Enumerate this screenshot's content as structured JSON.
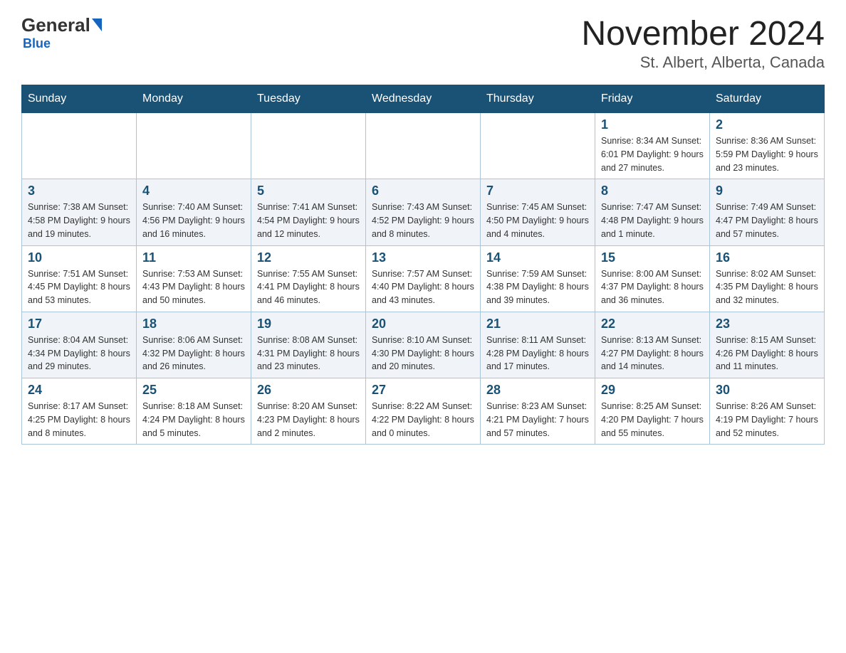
{
  "header": {
    "logo_text": "General",
    "logo_blue": "Blue",
    "main_title": "November 2024",
    "location": "St. Albert, Alberta, Canada"
  },
  "weekdays": [
    "Sunday",
    "Monday",
    "Tuesday",
    "Wednesday",
    "Thursday",
    "Friday",
    "Saturday"
  ],
  "weeks": [
    [
      {
        "day": "",
        "info": ""
      },
      {
        "day": "",
        "info": ""
      },
      {
        "day": "",
        "info": ""
      },
      {
        "day": "",
        "info": ""
      },
      {
        "day": "",
        "info": ""
      },
      {
        "day": "1",
        "info": "Sunrise: 8:34 AM\nSunset: 6:01 PM\nDaylight: 9 hours and 27 minutes."
      },
      {
        "day": "2",
        "info": "Sunrise: 8:36 AM\nSunset: 5:59 PM\nDaylight: 9 hours and 23 minutes."
      }
    ],
    [
      {
        "day": "3",
        "info": "Sunrise: 7:38 AM\nSunset: 4:58 PM\nDaylight: 9 hours and 19 minutes."
      },
      {
        "day": "4",
        "info": "Sunrise: 7:40 AM\nSunset: 4:56 PM\nDaylight: 9 hours and 16 minutes."
      },
      {
        "day": "5",
        "info": "Sunrise: 7:41 AM\nSunset: 4:54 PM\nDaylight: 9 hours and 12 minutes."
      },
      {
        "day": "6",
        "info": "Sunrise: 7:43 AM\nSunset: 4:52 PM\nDaylight: 9 hours and 8 minutes."
      },
      {
        "day": "7",
        "info": "Sunrise: 7:45 AM\nSunset: 4:50 PM\nDaylight: 9 hours and 4 minutes."
      },
      {
        "day": "8",
        "info": "Sunrise: 7:47 AM\nSunset: 4:48 PM\nDaylight: 9 hours and 1 minute."
      },
      {
        "day": "9",
        "info": "Sunrise: 7:49 AM\nSunset: 4:47 PM\nDaylight: 8 hours and 57 minutes."
      }
    ],
    [
      {
        "day": "10",
        "info": "Sunrise: 7:51 AM\nSunset: 4:45 PM\nDaylight: 8 hours and 53 minutes."
      },
      {
        "day": "11",
        "info": "Sunrise: 7:53 AM\nSunset: 4:43 PM\nDaylight: 8 hours and 50 minutes."
      },
      {
        "day": "12",
        "info": "Sunrise: 7:55 AM\nSunset: 4:41 PM\nDaylight: 8 hours and 46 minutes."
      },
      {
        "day": "13",
        "info": "Sunrise: 7:57 AM\nSunset: 4:40 PM\nDaylight: 8 hours and 43 minutes."
      },
      {
        "day": "14",
        "info": "Sunrise: 7:59 AM\nSunset: 4:38 PM\nDaylight: 8 hours and 39 minutes."
      },
      {
        "day": "15",
        "info": "Sunrise: 8:00 AM\nSunset: 4:37 PM\nDaylight: 8 hours and 36 minutes."
      },
      {
        "day": "16",
        "info": "Sunrise: 8:02 AM\nSunset: 4:35 PM\nDaylight: 8 hours and 32 minutes."
      }
    ],
    [
      {
        "day": "17",
        "info": "Sunrise: 8:04 AM\nSunset: 4:34 PM\nDaylight: 8 hours and 29 minutes."
      },
      {
        "day": "18",
        "info": "Sunrise: 8:06 AM\nSunset: 4:32 PM\nDaylight: 8 hours and 26 minutes."
      },
      {
        "day": "19",
        "info": "Sunrise: 8:08 AM\nSunset: 4:31 PM\nDaylight: 8 hours and 23 minutes."
      },
      {
        "day": "20",
        "info": "Sunrise: 8:10 AM\nSunset: 4:30 PM\nDaylight: 8 hours and 20 minutes."
      },
      {
        "day": "21",
        "info": "Sunrise: 8:11 AM\nSunset: 4:28 PM\nDaylight: 8 hours and 17 minutes."
      },
      {
        "day": "22",
        "info": "Sunrise: 8:13 AM\nSunset: 4:27 PM\nDaylight: 8 hours and 14 minutes."
      },
      {
        "day": "23",
        "info": "Sunrise: 8:15 AM\nSunset: 4:26 PM\nDaylight: 8 hours and 11 minutes."
      }
    ],
    [
      {
        "day": "24",
        "info": "Sunrise: 8:17 AM\nSunset: 4:25 PM\nDaylight: 8 hours and 8 minutes."
      },
      {
        "day": "25",
        "info": "Sunrise: 8:18 AM\nSunset: 4:24 PM\nDaylight: 8 hours and 5 minutes."
      },
      {
        "day": "26",
        "info": "Sunrise: 8:20 AM\nSunset: 4:23 PM\nDaylight: 8 hours and 2 minutes."
      },
      {
        "day": "27",
        "info": "Sunrise: 8:22 AM\nSunset: 4:22 PM\nDaylight: 8 hours and 0 minutes."
      },
      {
        "day": "28",
        "info": "Sunrise: 8:23 AM\nSunset: 4:21 PM\nDaylight: 7 hours and 57 minutes."
      },
      {
        "day": "29",
        "info": "Sunrise: 8:25 AM\nSunset: 4:20 PM\nDaylight: 7 hours and 55 minutes."
      },
      {
        "day": "30",
        "info": "Sunrise: 8:26 AM\nSunset: 4:19 PM\nDaylight: 7 hours and 52 minutes."
      }
    ]
  ]
}
